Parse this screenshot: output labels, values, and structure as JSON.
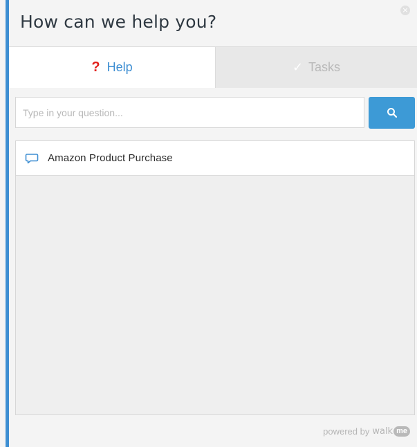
{
  "header": {
    "title": "How can we help you?"
  },
  "tabs": [
    {
      "label": "Help",
      "icon": "question-mark-icon",
      "active": true
    },
    {
      "label": "Tasks",
      "icon": "checkmark-icon",
      "active": false
    }
  ],
  "search": {
    "placeholder": "Type in your question...",
    "value": ""
  },
  "results": [
    {
      "label": "Amazon Product Purchase",
      "icon": "speech-bubble-icon"
    }
  ],
  "footer": {
    "powered_by": "powered by",
    "brand_word": "walk",
    "brand_badge": "me"
  },
  "colors": {
    "accent": "#3d8ed2",
    "search_button": "#3d9ad6",
    "help_mark": "#e2211c"
  }
}
